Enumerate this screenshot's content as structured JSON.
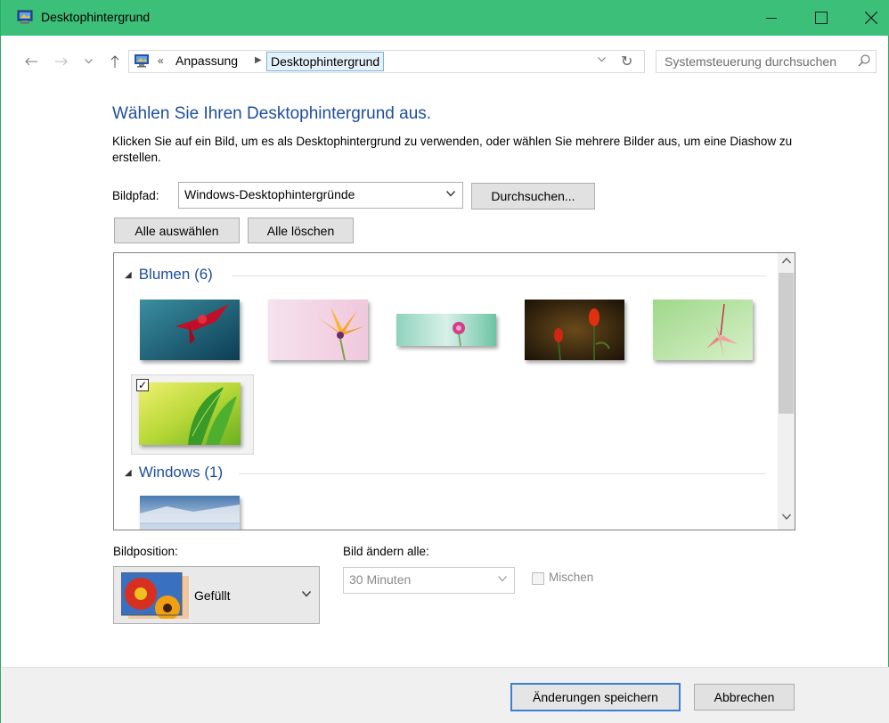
{
  "window": {
    "title": "Desktophintergrund",
    "accent_color": "#3cbf78"
  },
  "nav": {
    "back_icon": "back-arrow-icon",
    "forward_icon": "forward-arrow-icon",
    "recent_icon": "chevron-down-icon",
    "up_icon": "up-arrow-icon"
  },
  "address": {
    "overflow": "«",
    "crumbs": [
      "Anpassung",
      "Desktophintergrund"
    ],
    "dropdown": "⌵",
    "refresh": "↻"
  },
  "search": {
    "placeholder": "Systemsteuerung durchsuchen"
  },
  "content": {
    "heading": "Wählen Sie Ihren Desktophintergrund aus.",
    "description": "Klicken Sie auf ein Bild, um es als Desktophintergrund zu verwenden, oder wählen Sie mehrere Bilder aus, um eine Diashow zu erstellen.",
    "bildpfad_label": "Bildpfad:",
    "bildpfad_value": "Windows-Desktophintergründe",
    "browse_button": "Durchsuchen...",
    "select_all_button": "Alle auswählen",
    "clear_all_button": "Alle löschen"
  },
  "gallery": {
    "groups": [
      {
        "label": "Blumen (6)"
      },
      {
        "label": "Windows (1)"
      }
    ],
    "selected_index": 5
  },
  "position": {
    "label": "Bildposition:",
    "value": "Gefüllt"
  },
  "interval": {
    "label": "Bild ändern alle:",
    "value": "30 Minuten",
    "shuffle_label": "Mischen"
  },
  "footer": {
    "save_button": "Änderungen speichern",
    "cancel_button": "Abbrechen"
  }
}
